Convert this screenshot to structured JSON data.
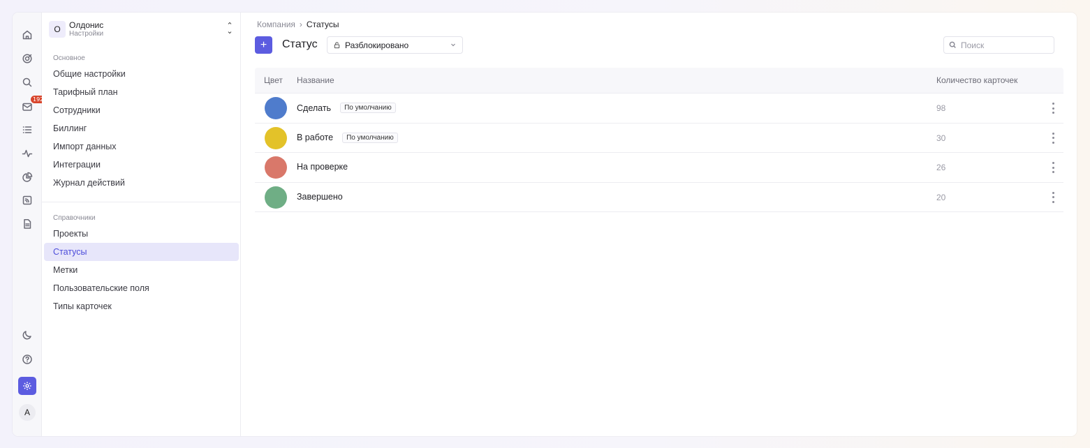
{
  "rail": {
    "inbox_badge": "192",
    "avatar_letter": "A"
  },
  "workspace": {
    "letter": "O",
    "name": "Олдонис",
    "subtitle": "Настройки"
  },
  "sidebar": {
    "section_main": "Основное",
    "main_items": [
      {
        "label": "Общие настройки"
      },
      {
        "label": "Тарифный план"
      },
      {
        "label": "Сотрудники"
      },
      {
        "label": "Биллинг"
      },
      {
        "label": "Импорт данных"
      },
      {
        "label": "Интеграции"
      },
      {
        "label": "Журнал действий"
      }
    ],
    "section_refs": "Справочники",
    "ref_items": [
      {
        "label": "Проекты"
      },
      {
        "label": "Статусы"
      },
      {
        "label": "Метки"
      },
      {
        "label": "Пользовательские поля"
      },
      {
        "label": "Типы карточек"
      }
    ]
  },
  "breadcrumb": {
    "parent": "Компания",
    "separator": "›",
    "current": "Статусы"
  },
  "header": {
    "add_label": "+",
    "title": "Статус",
    "filter_value": "Разблокировано",
    "search_placeholder": "Поиск"
  },
  "table": {
    "columns": {
      "color": "Цвет",
      "name": "Название",
      "count": "Количество карточек"
    },
    "rows": [
      {
        "name": "Сделать",
        "tag": "По умолчанию",
        "count": "98",
        "color": "#4f7ccc"
      },
      {
        "name": "В работе",
        "tag": "По умолчанию",
        "count": "30",
        "color": "#e3c229"
      },
      {
        "name": "На проверке",
        "tag": "",
        "count": "26",
        "color": "#d9786a"
      },
      {
        "name": "Завершено",
        "tag": "",
        "count": "20",
        "color": "#6fae85"
      }
    ]
  },
  "colors": {
    "accent": "#5c5ce0",
    "active_bg": "#e7e6fa",
    "badge": "#d8452c"
  }
}
